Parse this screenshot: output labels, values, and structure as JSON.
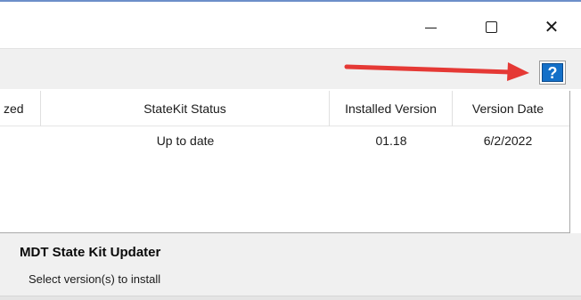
{
  "window": {
    "controls": {
      "minimize_icon": "minimize-icon",
      "maximize_icon": "maximize-icon",
      "close_icon": "close-icon",
      "close_glyph": "✕"
    }
  },
  "toolbar": {
    "help_label": "?",
    "help_icon": "help-icon",
    "annotation_arrow_color": "#e53935"
  },
  "table": {
    "columns": [
      "zed",
      "StateKit Status",
      "Installed Version",
      "Version Date"
    ],
    "rows": [
      {
        "truncated": "",
        "status": "Up to date",
        "installed_version": "01.18",
        "version_date": "6/2/2022"
      }
    ]
  },
  "panel": {
    "title": "MDT State Kit Updater",
    "subtitle": "Select version(s) to install"
  },
  "colors": {
    "accent": "#6d8fc9",
    "help_button": "#1470c8",
    "panel_bg": "#f0f0f0"
  }
}
